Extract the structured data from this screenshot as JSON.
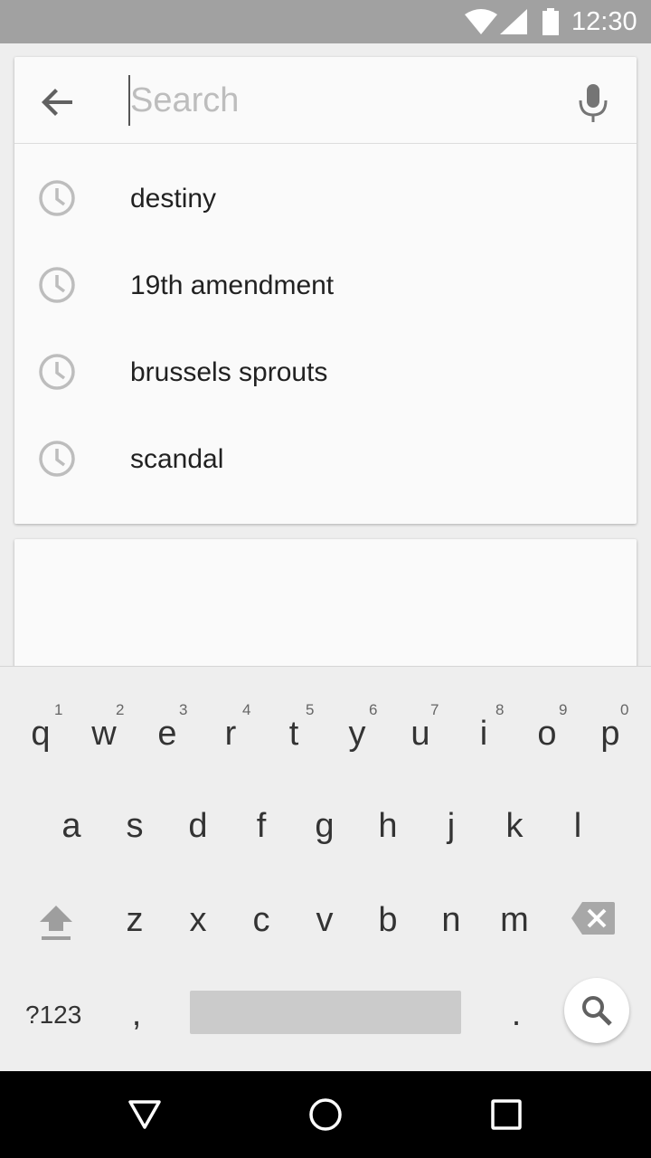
{
  "status_bar": {
    "time": "12:30",
    "icons": [
      "wifi-icon",
      "cell-signal-icon",
      "battery-icon"
    ]
  },
  "search": {
    "placeholder": "Search",
    "value": "",
    "icons": [
      "back-arrow-icon",
      "microphone-icon"
    ]
  },
  "suggestions": [
    {
      "label": "destiny",
      "icon": "history-clock-icon"
    },
    {
      "label": "19th amendment",
      "icon": "history-clock-icon"
    },
    {
      "label": "brussels sprouts",
      "icon": "history-clock-icon"
    },
    {
      "label": "scandal",
      "icon": "history-clock-icon"
    }
  ],
  "keyboard": {
    "row1": [
      {
        "ch": "q",
        "hint": "1"
      },
      {
        "ch": "w",
        "hint": "2"
      },
      {
        "ch": "e",
        "hint": "3"
      },
      {
        "ch": "r",
        "hint": "4"
      },
      {
        "ch": "t",
        "hint": "5"
      },
      {
        "ch": "y",
        "hint": "6"
      },
      {
        "ch": "u",
        "hint": "7"
      },
      {
        "ch": "i",
        "hint": "8"
      },
      {
        "ch": "o",
        "hint": "9"
      },
      {
        "ch": "p",
        "hint": "0"
      }
    ],
    "row2": [
      "a",
      "s",
      "d",
      "f",
      "g",
      "h",
      "j",
      "k",
      "l"
    ],
    "row3": [
      "z",
      "x",
      "c",
      "v",
      "b",
      "n",
      "m"
    ],
    "symbols_label": "?123",
    "comma": ",",
    "period": ".",
    "icons": [
      "shift-icon",
      "backspace-icon",
      "search-icon"
    ]
  },
  "nav_bar": {
    "icons": [
      "nav-back-icon",
      "nav-home-icon",
      "nav-recents-icon"
    ]
  },
  "colors": {
    "status_bar": "#a1a1a1",
    "card": "#fafafa",
    "keyboard": "#eeeeee",
    "icon_gray": "#bdbdbd",
    "nav_bar": "#000000"
  }
}
